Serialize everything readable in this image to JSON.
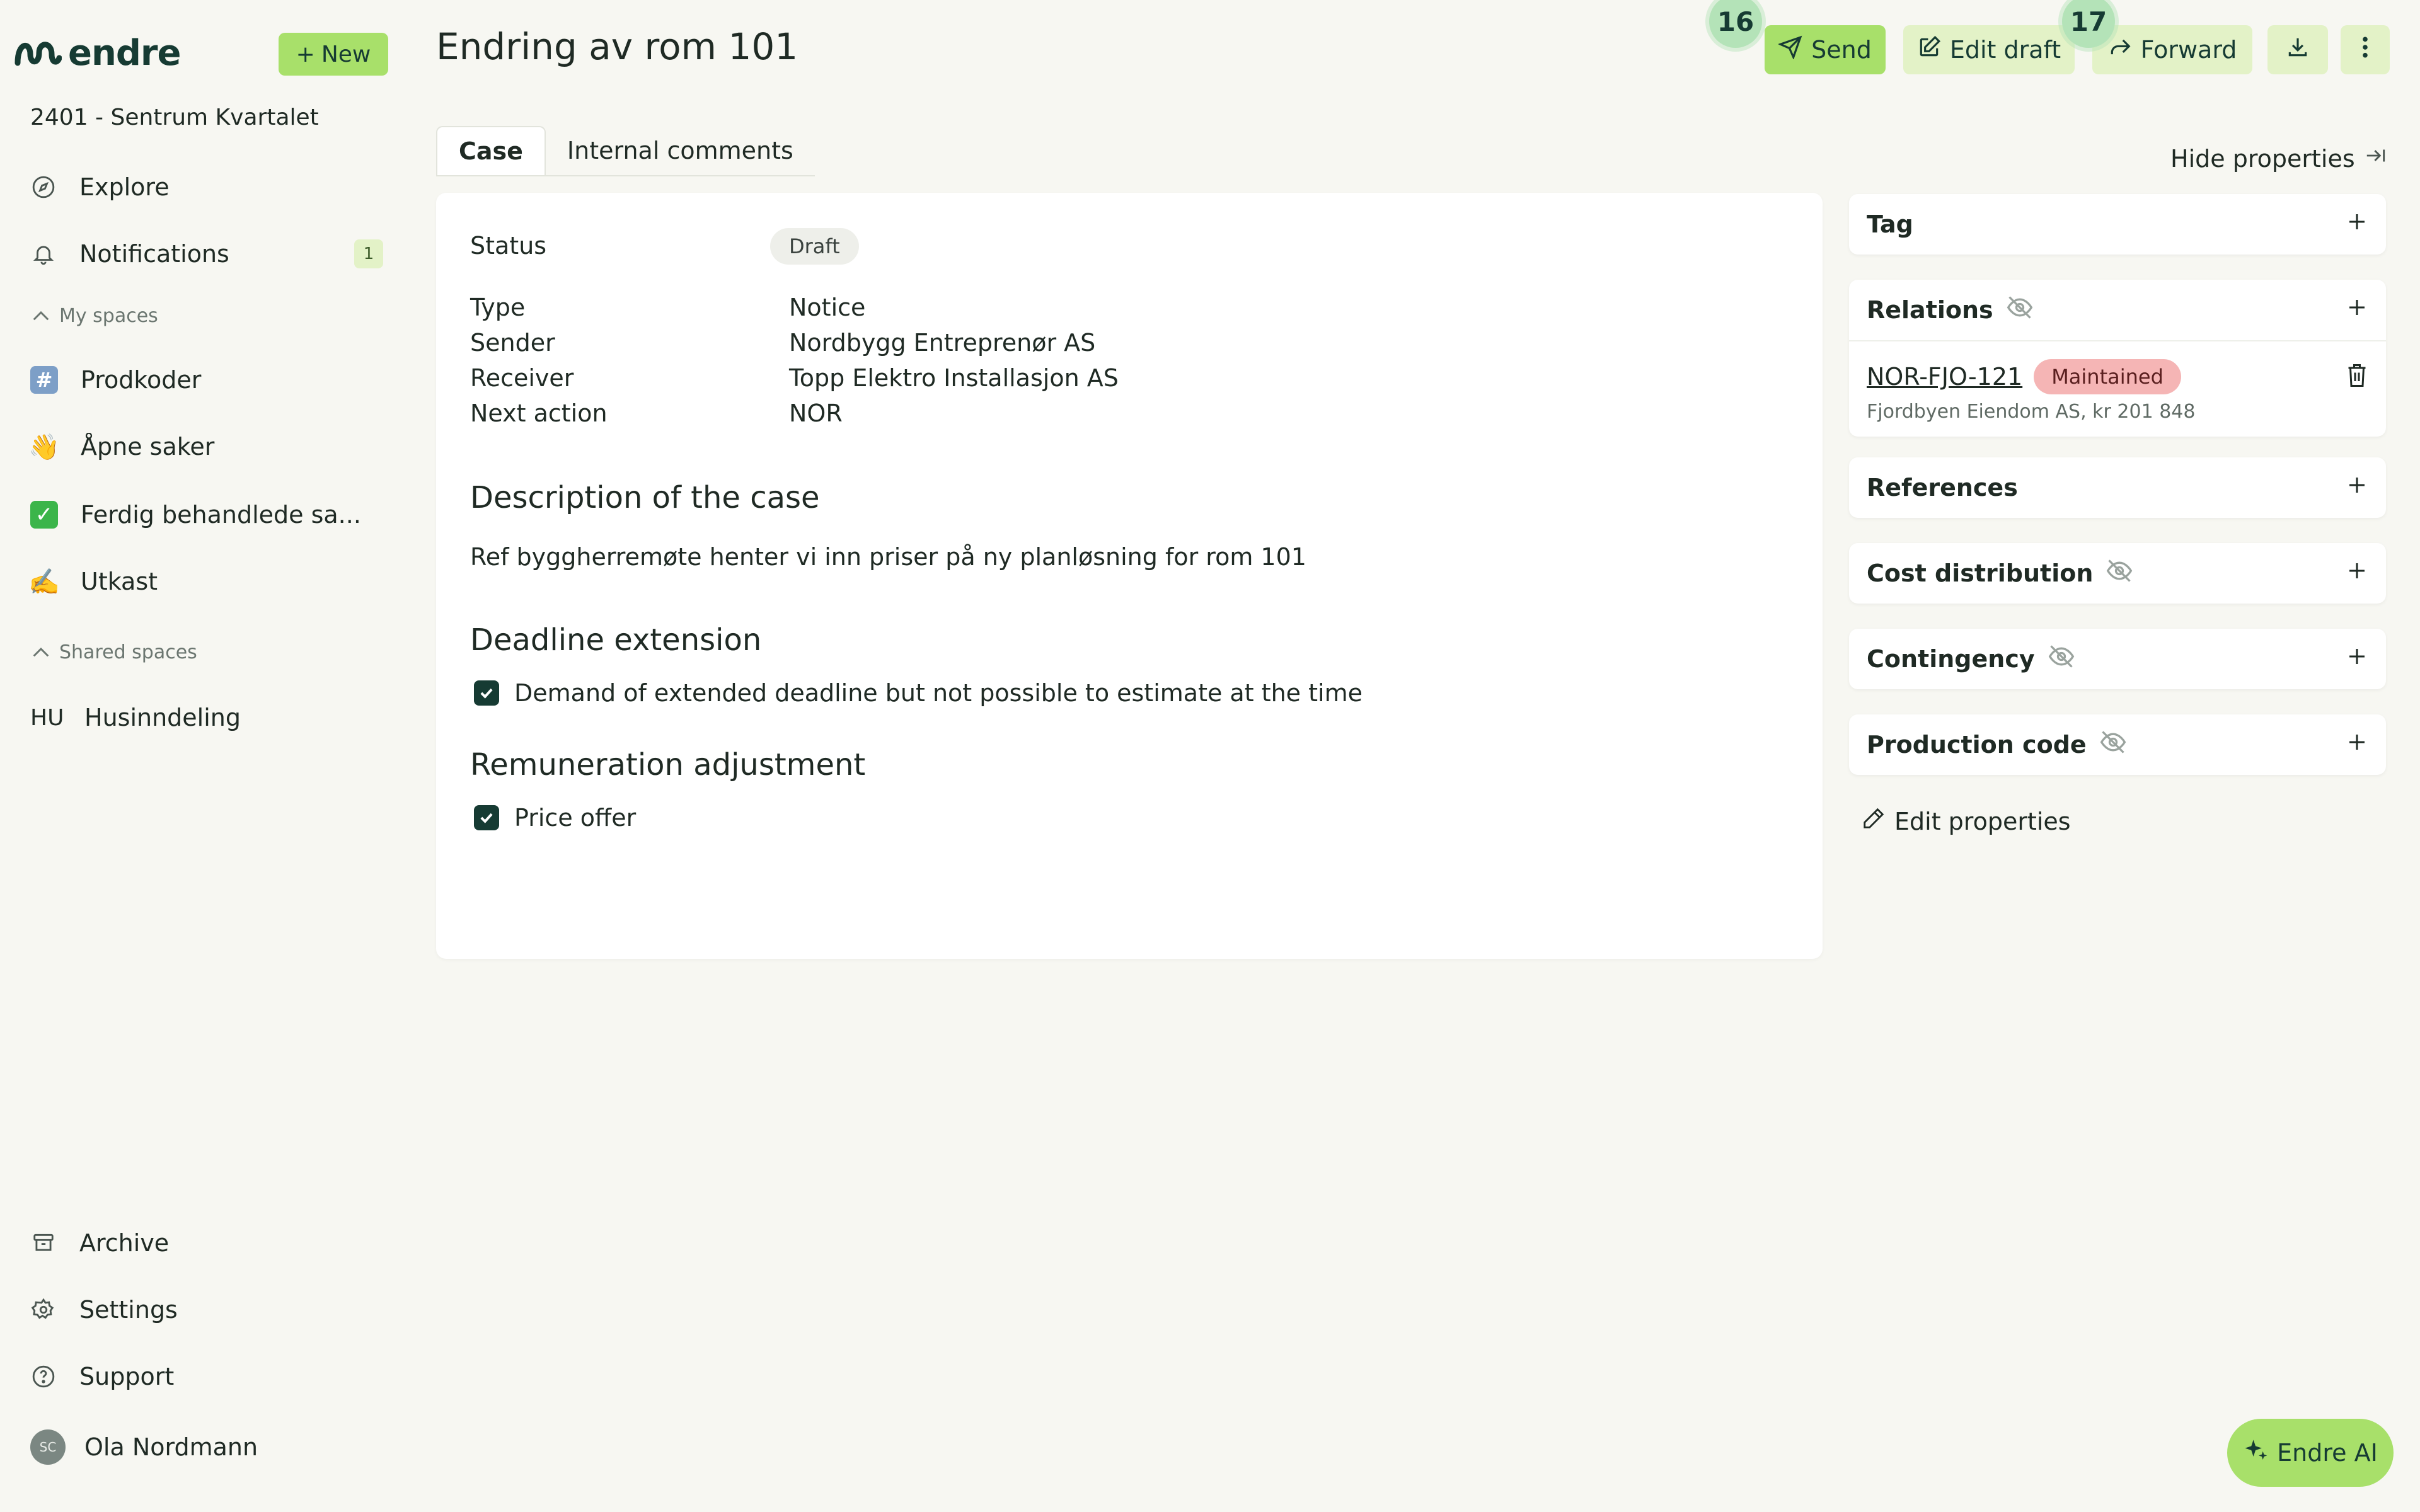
{
  "app": {
    "brand": "endre",
    "new_label": "New",
    "project": "2401 - Sentrum Kvartalet"
  },
  "sidebar": {
    "explore": "Explore",
    "notifications": "Notifications",
    "notifications_count": "1",
    "my_spaces_label": "My spaces",
    "my_spaces": [
      {
        "label": "Prodkoder",
        "icon": "#"
      },
      {
        "label": "Åpne saker",
        "icon": "👋"
      },
      {
        "label": "Ferdig behandlede sa...",
        "icon": "✓"
      },
      {
        "label": "Utkast",
        "icon": "✍️"
      }
    ],
    "shared_spaces_label": "Shared spaces",
    "shared_spaces": [
      {
        "label": "Husinndeling",
        "icon": "HU"
      }
    ],
    "archive": "Archive",
    "settings": "Settings",
    "support": "Support",
    "user": {
      "name": "Ola Nordmann",
      "initials": "SC"
    }
  },
  "header": {
    "title": "Endring av rom 101",
    "send": "Send",
    "edit_draft": "Edit draft",
    "forward": "Forward",
    "badge_send": "16",
    "badge_forward": "17"
  },
  "tabs": {
    "case": "Case",
    "comments": "Internal comments",
    "hide_properties": "Hide properties"
  },
  "case": {
    "status_label": "Status",
    "status_value": "Draft",
    "fields": [
      {
        "key": "Type",
        "value": "Notice"
      },
      {
        "key": "Sender",
        "value": "Nordbygg Entreprenør AS"
      },
      {
        "key": "Receiver",
        "value": "Topp Elektro Installasjon AS"
      },
      {
        "key": "Next action",
        "value": "NOR"
      }
    ],
    "description_title": "Description of the case",
    "description_text": "Ref byggherremøte henter vi inn priser på ny planløsning for rom 101",
    "deadline_title": "Deadline extension",
    "deadline_item": "Demand of extended deadline but not possible to estimate at the time",
    "remuneration_title": "Remuneration adjustment",
    "remuneration_item": "Price offer"
  },
  "properties": {
    "tag": "Tag",
    "relations": "Relations",
    "relation_item": {
      "id": "NOR-FJO-121",
      "status": "Maintained",
      "detail": "Fjordbyen Eiendom AS, kr 201 848"
    },
    "references": "References",
    "cost_distribution": "Cost distribution",
    "contingency": "Contingency",
    "production_code": "Production code",
    "edit_properties": "Edit properties"
  },
  "ai": {
    "label": "Endre AI"
  },
  "colors": {
    "accent": "#a8e06a",
    "accent_soft": "#e3f2c7",
    "brand_dark": "#163b33",
    "maintained_badge": "#f5b5b5",
    "background": "#f7f7f2"
  }
}
